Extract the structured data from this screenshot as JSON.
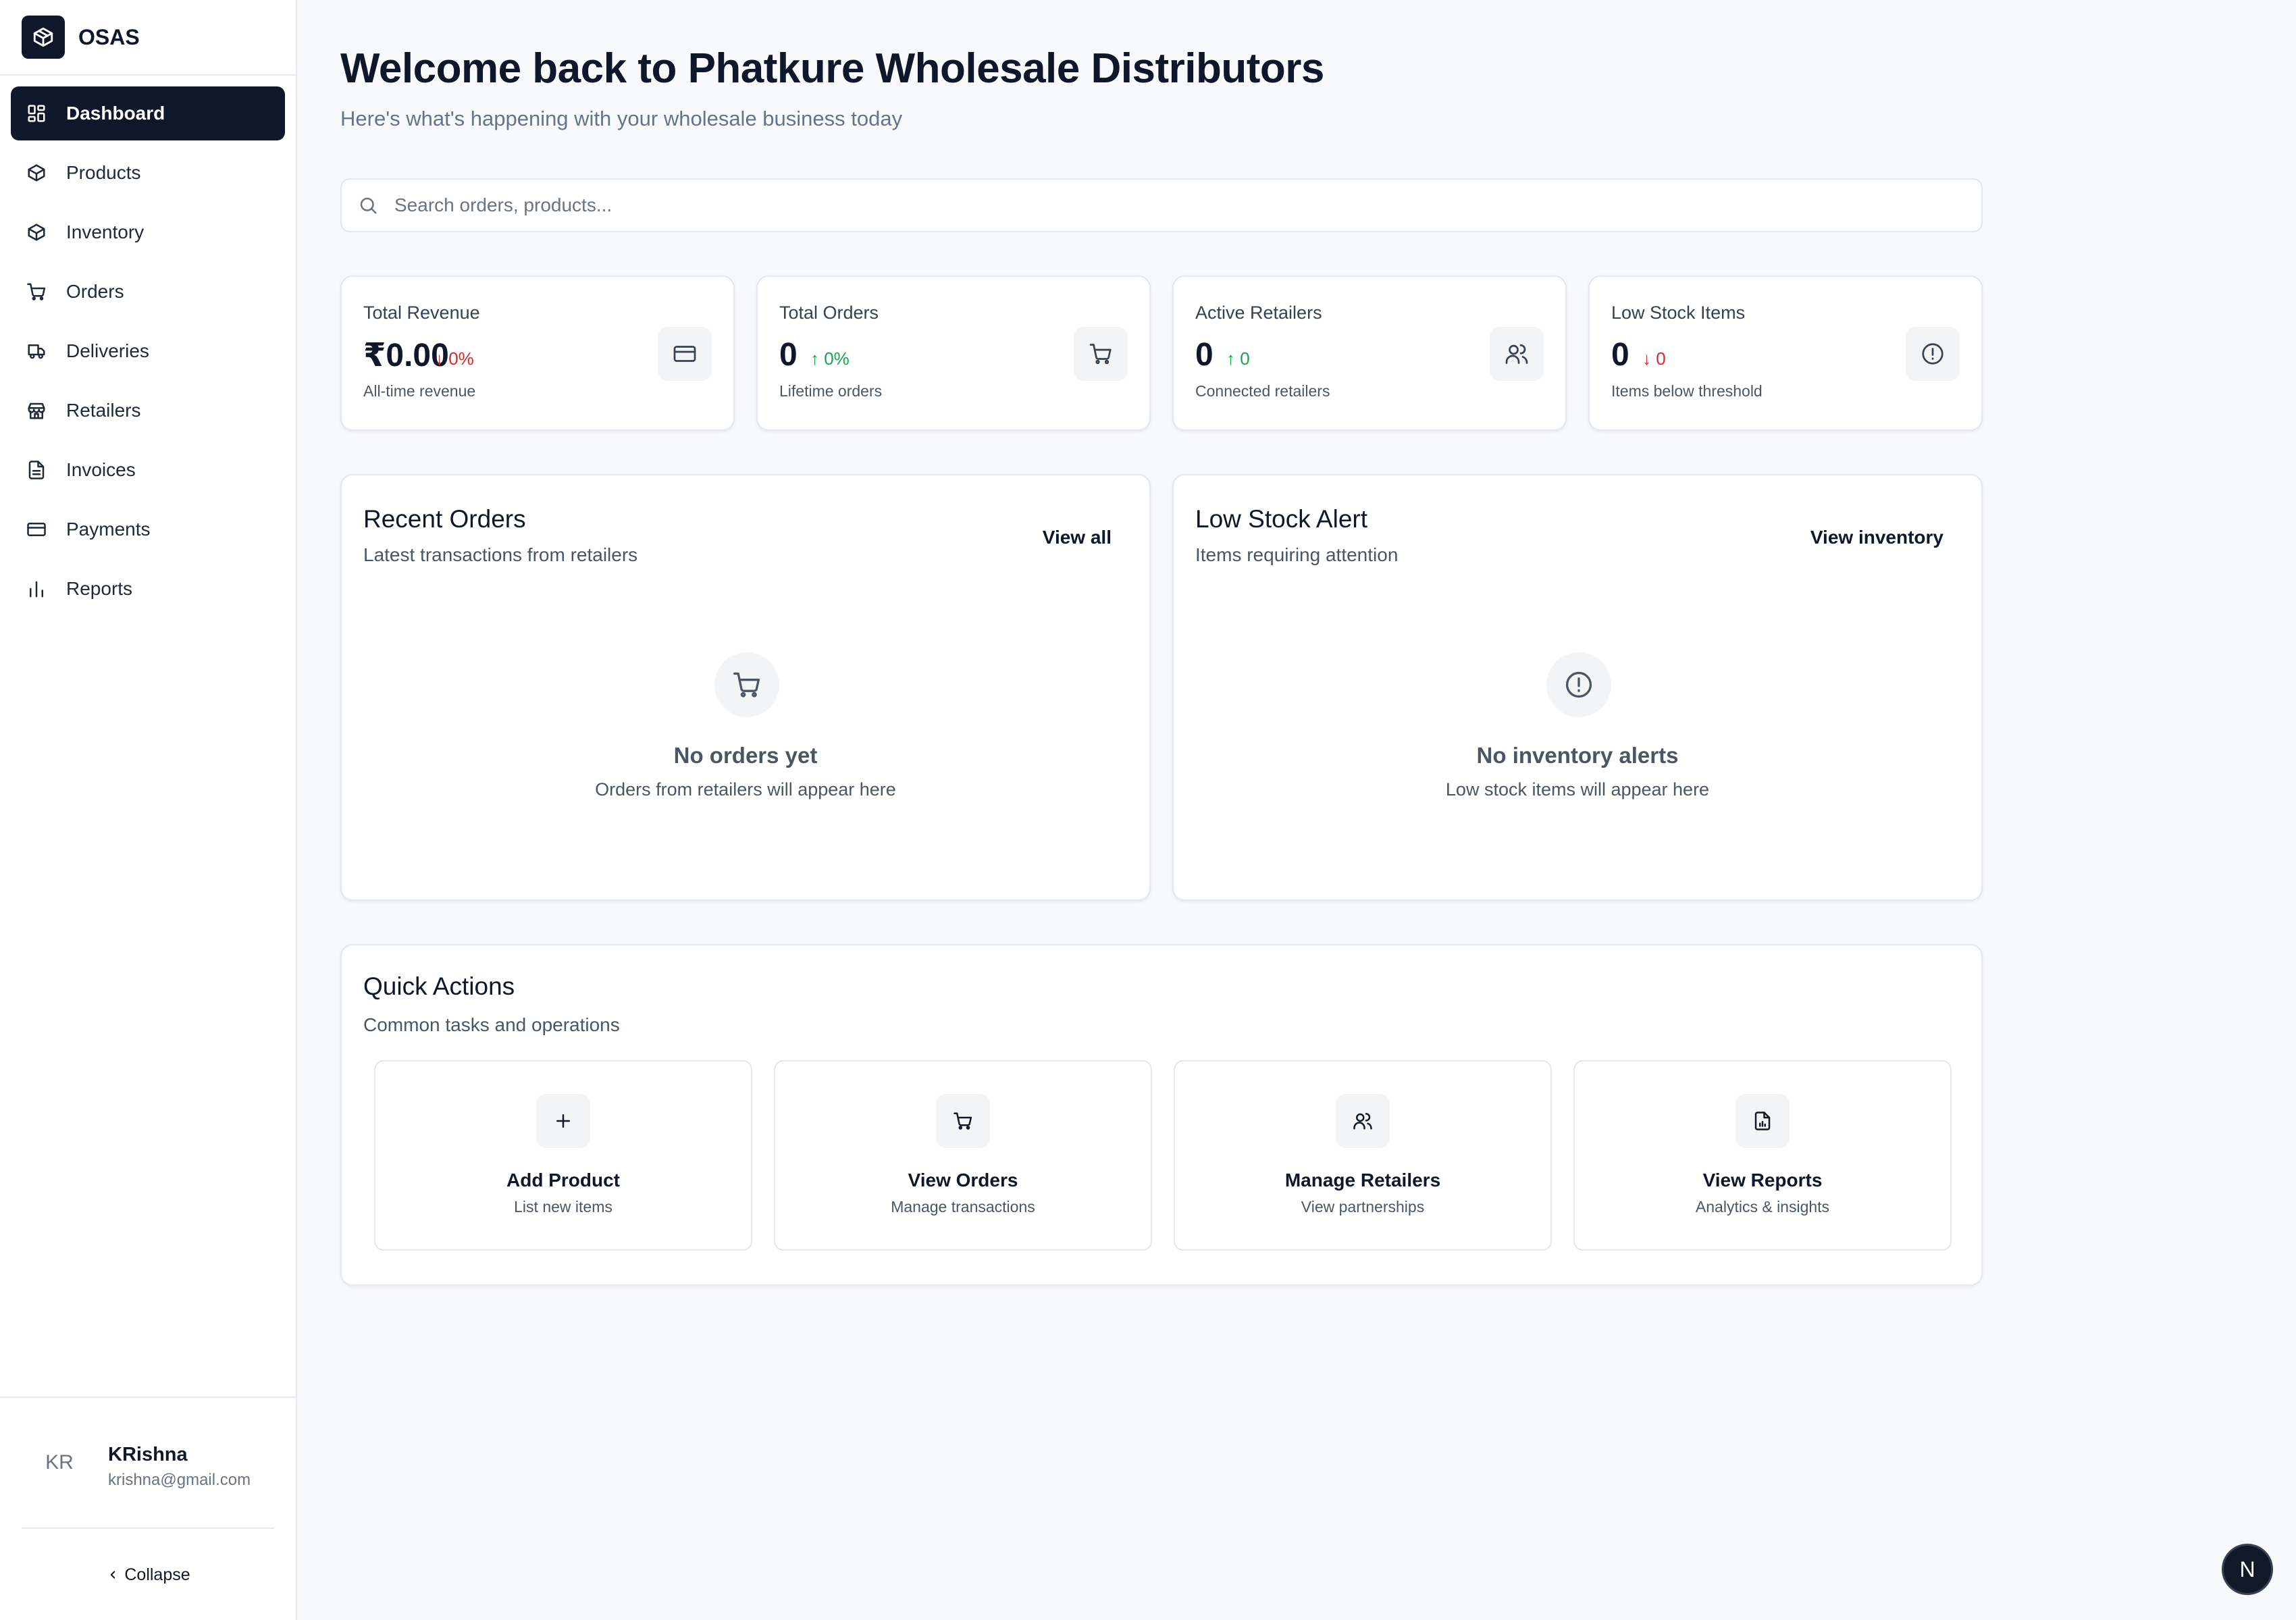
{
  "brand": {
    "name": "OSAS"
  },
  "sidebar": {
    "items": [
      {
        "label": "Dashboard",
        "icon": "layout-dashboard-icon",
        "active": true
      },
      {
        "label": "Products",
        "icon": "package-icon"
      },
      {
        "label": "Inventory",
        "icon": "package-icon"
      },
      {
        "label": "Orders",
        "icon": "shopping-cart-icon"
      },
      {
        "label": "Deliveries",
        "icon": "truck-icon"
      },
      {
        "label": "Retailers",
        "icon": "store-icon"
      },
      {
        "label": "Invoices",
        "icon": "file-text-icon"
      },
      {
        "label": "Payments",
        "icon": "credit-card-icon"
      },
      {
        "label": "Reports",
        "icon": "bar-chart-icon"
      }
    ],
    "user": {
      "initials": "KR",
      "name": "KRishna",
      "email": "krishna@gmail.com"
    },
    "collapse_label": "Collapse"
  },
  "header": {
    "title": "Welcome back to Phatkure Wholesale Distributors",
    "subtitle": "Here's what's happening with your wholesale business today"
  },
  "search": {
    "placeholder": "Search orders, products...",
    "value": ""
  },
  "stats": [
    {
      "title": "Total Revenue",
      "value": "₹0.00",
      "change": "↓ 0%",
      "trend": "down",
      "description": "All-time revenue",
      "icon": "credit-card-icon"
    },
    {
      "title": "Total Orders",
      "value": "0",
      "change": "↑ 0%",
      "trend": "up",
      "description": "Lifetime orders",
      "icon": "shopping-cart-icon"
    },
    {
      "title": "Active Retailers",
      "value": "0",
      "change": "↑ 0",
      "trend": "up",
      "description": "Connected retailers",
      "icon": "users-icon"
    },
    {
      "title": "Low Stock Items",
      "value": "0",
      "change": "↓ 0",
      "trend": "down",
      "description": "Items below threshold",
      "icon": "alert-circle-icon"
    }
  ],
  "recent_orders": {
    "title": "Recent Orders",
    "subtitle": "Latest transactions from retailers",
    "link": "View all",
    "empty_title": "No orders yet",
    "empty_subtitle": "Orders from retailers will appear here"
  },
  "low_stock": {
    "title": "Low Stock Alert",
    "subtitle": "Items requiring attention",
    "link": "View inventory",
    "empty_title": "No inventory alerts",
    "empty_subtitle": "Low stock items will appear here"
  },
  "quick_actions": {
    "title": "Quick Actions",
    "subtitle": "Common tasks and operations",
    "items": [
      {
        "title": "Add Product",
        "subtitle": "List new items",
        "icon": "plus-icon"
      },
      {
        "title": "View Orders",
        "subtitle": "Manage transactions",
        "icon": "shopping-cart-icon"
      },
      {
        "title": "Manage Retailers",
        "subtitle": "View partnerships",
        "icon": "users-icon"
      },
      {
        "title": "View Reports",
        "subtitle": "Analytics & insights",
        "icon": "file-chart-icon"
      }
    ]
  },
  "dev_badge": {
    "label": "N"
  },
  "colors": {
    "primary": "#0f172a",
    "danger": "#dc2626",
    "success": "#16a34a",
    "muted": "#64748b"
  }
}
